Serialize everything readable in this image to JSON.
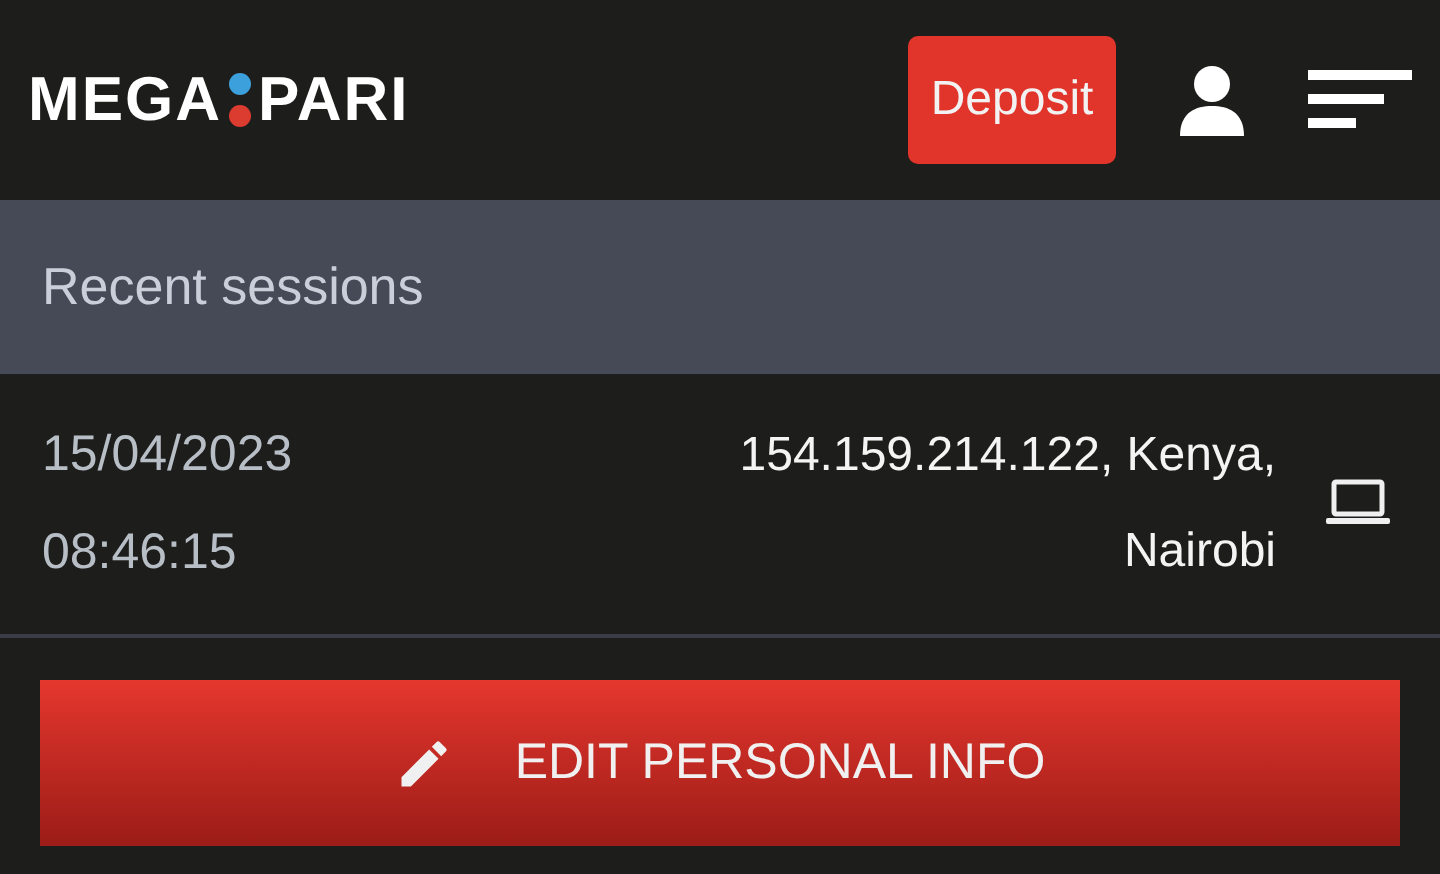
{
  "header": {
    "logo": {
      "left": "MEGA",
      "right": "PARI"
    },
    "deposit_button": "Deposit"
  },
  "section": {
    "title": "Recent sessions"
  },
  "sessions": [
    {
      "date": "15/04/2023",
      "time": "08:46:15",
      "location_line_1": "154.159.214.122, Kenya,",
      "location_line_2": "Nairobi",
      "kind": "laptop"
    }
  ],
  "edit_button": "EDIT PERSONAL INFO"
}
